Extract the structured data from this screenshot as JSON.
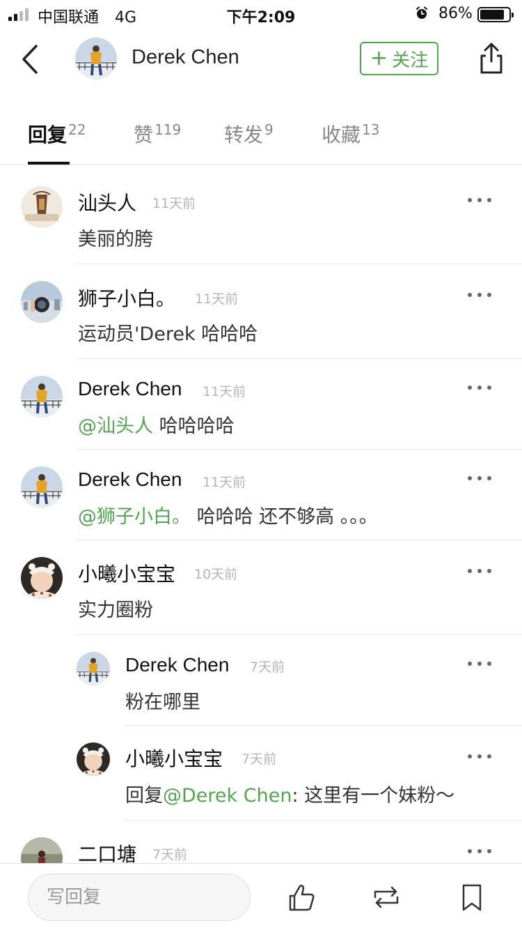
{
  "status_bar": {
    "carrier": "中国联通",
    "network": "4G",
    "time": "下午2:09",
    "battery_percent": "86%",
    "battery_level": 0.86
  },
  "header": {
    "user_name": "Derek Chen",
    "follow_label": "关注",
    "follow_plus": "+"
  },
  "tabs": [
    {
      "label": "回复",
      "count": "22"
    },
    {
      "label": "赞",
      "count": "119"
    },
    {
      "label": "转发",
      "count": "9"
    },
    {
      "label": "收藏",
      "count": "13"
    }
  ],
  "comments": [
    {
      "name": "汕头人",
      "time": "11天前",
      "text": "美丽的胯"
    },
    {
      "name": "狮子小白。",
      "time": "11天前",
      "text": "运动员'Derek  哈哈哈"
    },
    {
      "name": "Derek Chen",
      "time": "11天前",
      "mention": "@汕头人",
      "text": " 哈哈哈哈"
    },
    {
      "name": "Derek Chen",
      "time": "11天前",
      "mention": "@狮子小白。",
      "text": " 哈哈哈 还不够高 。。。"
    },
    {
      "name": "小曦小宝宝",
      "time": "10天前",
      "text": "实力圈粉"
    },
    {
      "name": "Derek Chen",
      "time": "7天前",
      "text": "粉在哪里"
    },
    {
      "name": "小曦小宝宝",
      "time": "7天前",
      "prefix": "回复",
      "mention": "@Derek Chen",
      "text": ": 这里有一个妹粉～"
    },
    {
      "name": "二口塘",
      "time": "7天前"
    }
  ],
  "bottom_bar": {
    "reply_placeholder": "写回复"
  },
  "colors": {
    "accent_green": "#53a451",
    "divider": "#e6e6e6",
    "muted_text": "#b5b5b5"
  },
  "icons": [
    "back-chevron-icon",
    "share-icon",
    "more-dots-icon",
    "thumbs-up-icon",
    "repost-icon",
    "bookmark-icon",
    "alarm-icon",
    "signal-icon",
    "battery-icon"
  ]
}
